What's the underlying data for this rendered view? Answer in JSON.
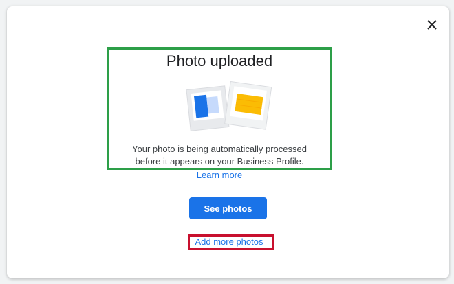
{
  "dialog": {
    "title": "Photo uploaded",
    "description_line1": "Your photo is being automatically processed",
    "description_line2": "before it appears on your Business Profile.",
    "learn_more": "Learn more",
    "see_photos": "See photos",
    "add_more_photos": "Add more photos",
    "close_icon": "close-icon"
  },
  "colors": {
    "primary": "#1a73e8",
    "highlight_green": "#2d9f48",
    "highlight_red": "#c8102e"
  }
}
